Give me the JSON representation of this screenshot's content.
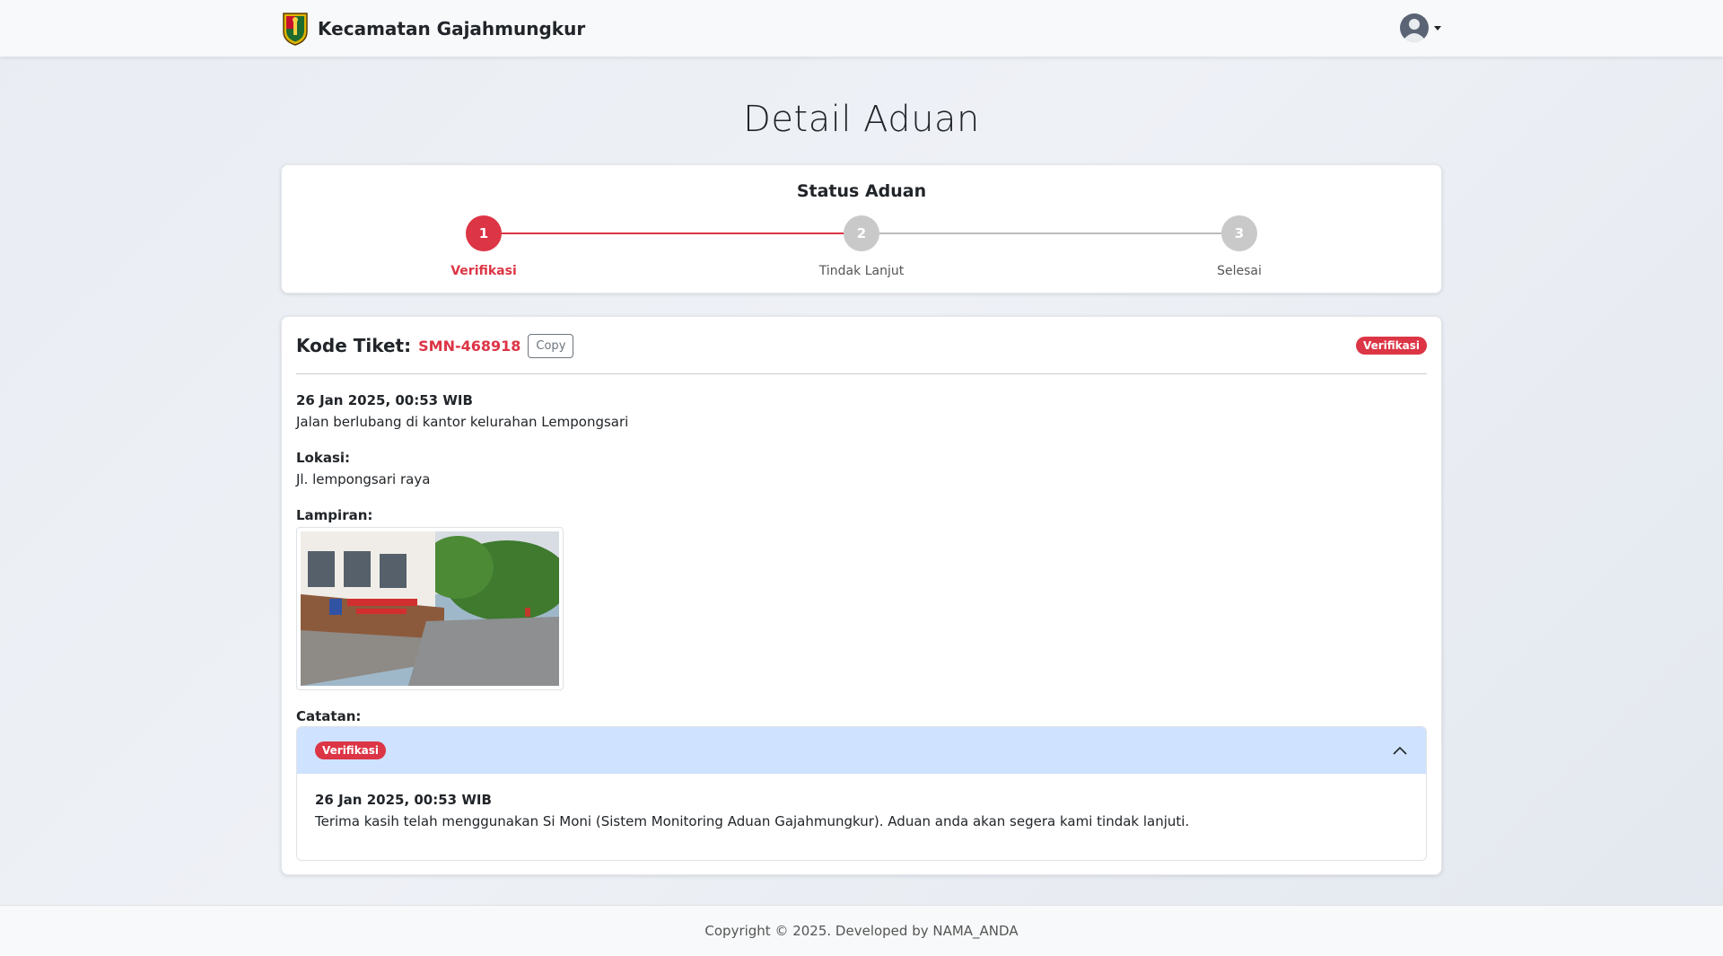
{
  "navbar": {
    "brand_title": "Kecamatan Gajahmungkur",
    "logo_icon": "coat-of-arms-icon",
    "user_icon": "user-avatar-icon"
  },
  "page": {
    "title": "Detail Aduan"
  },
  "status": {
    "title": "Status Aduan",
    "current_step": 1,
    "steps": [
      {
        "number": "1",
        "label": "Verifikasi",
        "active": true
      },
      {
        "number": "2",
        "label": "Tindak Lanjut",
        "active": false
      },
      {
        "number": "3",
        "label": "Selesai",
        "active": false
      }
    ]
  },
  "ticket": {
    "label": "Kode Tiket:",
    "code": "SMN-468918",
    "copy_label": "Copy",
    "status_badge": "Verifikasi",
    "datetime": "26 Jan 2025, 00:53 WIB",
    "description": "Jalan berlubang di kantor kelurahan Lempongsari",
    "location_label": "Lokasi:",
    "location": "Jl. lempongsari raya",
    "attachment_label": "Lampiran:",
    "notes_label": "Catatan:"
  },
  "notes": [
    {
      "badge": "Verifikasi",
      "datetime": "26 Jan 2025, 00:53 WIB",
      "message": "Terima kasih telah menggunakan Si Moni (Sistem Monitoring Aduan Gajahmungkur). Aduan anda akan segera kami tindak lanjuti."
    }
  ],
  "footer": {
    "text": "Copyright © 2025. Developed by NAMA_ANDA"
  },
  "colors": {
    "accent": "#dc3545",
    "inactive": "#c9c9c9",
    "accordion_header": "#cfe2ff"
  }
}
